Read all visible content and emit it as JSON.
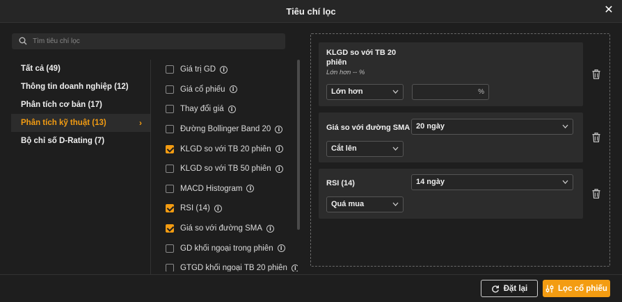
{
  "dialog": {
    "title": "Tiêu chí lọc"
  },
  "search": {
    "placeholder": "Tìm tiêu chí lọc"
  },
  "categories": [
    {
      "label": "Tất cả (49)",
      "active": false
    },
    {
      "label": "Thông tin doanh nghiệp (12)",
      "active": false
    },
    {
      "label": "Phân tích cơ bản (17)",
      "active": false
    },
    {
      "label": "Phân tích kỹ thuật (13)",
      "active": true
    },
    {
      "label": "Bộ chỉ số D-Rating (7)",
      "active": false
    }
  ],
  "criteria": [
    {
      "label": "Giá trị GD",
      "checked": false
    },
    {
      "label": "Giá cổ phiếu",
      "checked": false
    },
    {
      "label": "Thay đổi giá",
      "checked": false
    },
    {
      "label": "Đường Bollinger Band 20",
      "checked": false
    },
    {
      "label": "KLGD so với TB 20 phiên",
      "checked": true
    },
    {
      "label": "KLGD so với TB 50 phiên",
      "checked": false
    },
    {
      "label": "MACD Histogram",
      "checked": false
    },
    {
      "label": "RSI (14)",
      "checked": true
    },
    {
      "label": "Giá so với đường SMA",
      "checked": true
    },
    {
      "label": "GD khối ngoại trong phiên",
      "checked": false
    },
    {
      "label": "GTGD khối ngoại TB 20 phiên",
      "checked": false
    }
  ],
  "cards": {
    "klgd": {
      "title_line1": "KLGD so với TB 20",
      "title_line2": "phiên",
      "subtitle": "Lớn hơn -- %",
      "operator": "Lớn hơn",
      "value": "",
      "unit": "%"
    },
    "sma": {
      "title": "Giá so với đường SMA",
      "period": "20 ngày",
      "operator": "Cắt lên"
    },
    "rsi": {
      "title": "RSI (14)",
      "period": "14 ngày",
      "operator": "Quá mua"
    }
  },
  "footer": {
    "reset_label": "Đặt lại",
    "filter_label": "Lọc cổ phiếu"
  },
  "colors": {
    "accent": "#f39c12",
    "background": "#1e1e1e",
    "card": "#2c2c2c"
  }
}
